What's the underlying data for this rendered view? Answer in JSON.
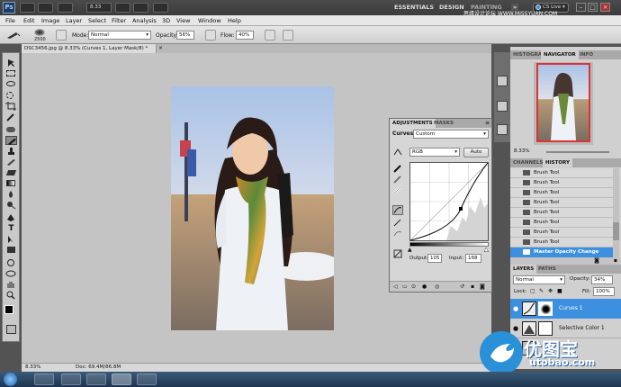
{
  "app": {
    "logo": "Ps",
    "zoom": "8.33"
  },
  "workspaces": {
    "essentials": "ESSENTIALS",
    "design": "DESIGN",
    "painting": "PAINTING",
    "more": "»",
    "cslive": "CS Live ▾"
  },
  "watermark_top": "思缘设计论坛 WWW.MISSYUAN.COM",
  "menu": [
    "File",
    "Edit",
    "Image",
    "Layer",
    "Select",
    "Filter",
    "Analysis",
    "3D",
    "View",
    "Window",
    "Help"
  ],
  "options": {
    "brush_size": "2500",
    "mode_label": "Mode:",
    "mode_value": "Normal",
    "opacity_label": "Opacity:",
    "opacity_value": "56%",
    "flow_label": "Flow:",
    "flow_value": "40%"
  },
  "document": {
    "tab_title": "DSC3456.jpg @ 8.33% (Curves 1, Layer Mask/8) *",
    "status_zoom": "8.33%",
    "status_doc": "Doc: 69.4M/86.8M"
  },
  "adjustments": {
    "tabs": [
      "ADJUSTMENTS",
      "MASKS"
    ],
    "title": "Curves",
    "preset": "Custom",
    "channel": "RGB",
    "auto_label": "Auto",
    "output_label": "Output:",
    "output_value": "105",
    "input_label": "Input:",
    "input_value": "168"
  },
  "navigator": {
    "tabs": [
      "HISTOGRAM",
      "NAVIGATOR",
      "INFO"
    ],
    "zoom": "8.33%"
  },
  "history": {
    "tabs": [
      "CHANNELS",
      "HISTORY"
    ],
    "items": [
      "Brush Tool",
      "Brush Tool",
      "Brush Tool",
      "Brush Tool",
      "Brush Tool",
      "Brush Tool",
      "Brush Tool",
      "Brush Tool",
      "Master Opacity Change"
    ]
  },
  "layers": {
    "tabs": [
      "LAYERS",
      "PATHS"
    ],
    "blend_mode": "Normal",
    "opacity_label": "Opacity:",
    "opacity_value": "34%",
    "lock_label": "Lock:",
    "fill_label": "Fill:",
    "fill_value": "100%",
    "items": [
      "Curves 1",
      "Selective Color 1"
    ]
  },
  "watermark_bottom": {
    "brand": "优图宝",
    "url": "utobao.com"
  },
  "colors": {
    "selection": "#3d8fe0",
    "panel": "#d0d0d0",
    "appbar": "#3c3c3c",
    "canvas": "#c4c4c4"
  }
}
